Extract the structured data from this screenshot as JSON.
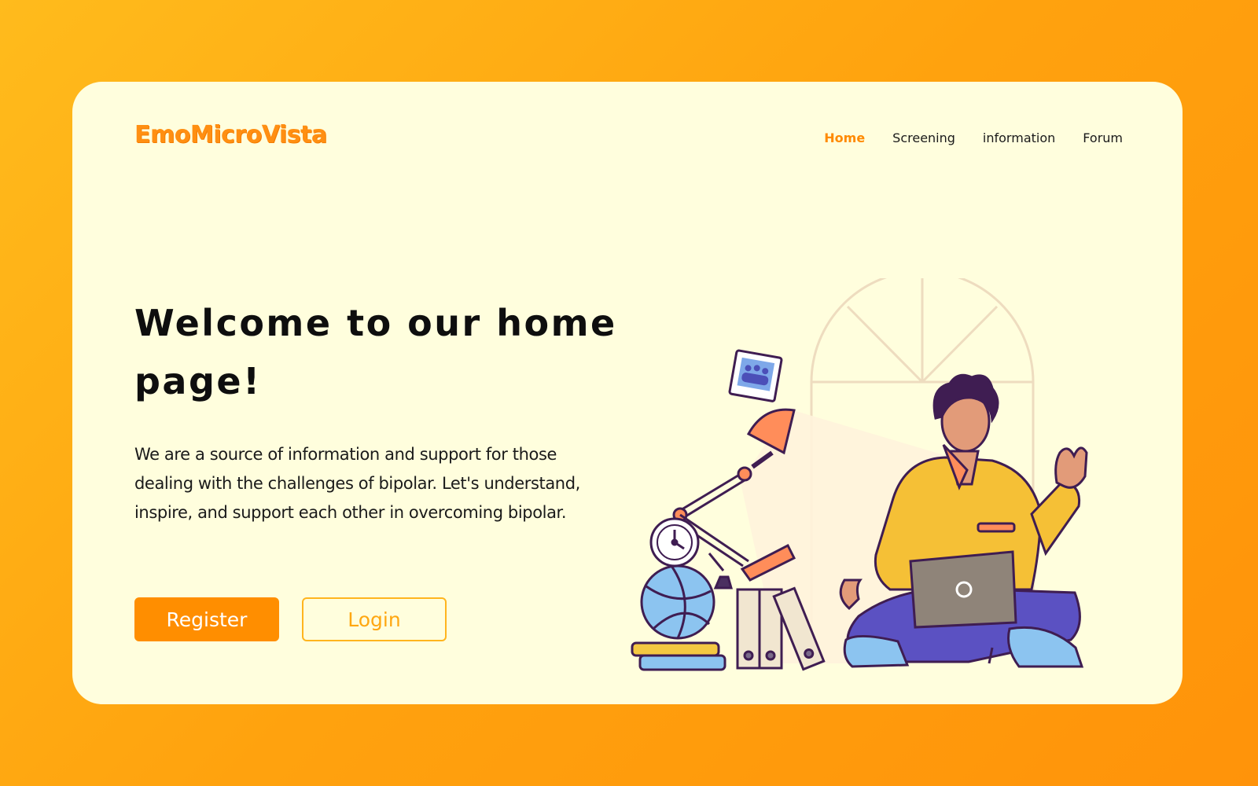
{
  "brand": {
    "name": "EmoMicroVista"
  },
  "nav": {
    "items": [
      {
        "label": "Home",
        "active": true
      },
      {
        "label": "Screening",
        "active": false
      },
      {
        "label": "information",
        "active": false
      },
      {
        "label": "Forum",
        "active": false
      }
    ]
  },
  "hero": {
    "title": "Welcome to our home page!",
    "description": "We are a source of information and support for those dealing with the challenges of bipolar. Let's understand, inspire, and support each other in overcoming bipolar.",
    "register_label": "Register",
    "login_label": "Login"
  },
  "colors": {
    "background_gradient": [
      "#FFBB1C",
      "#FF930A"
    ],
    "card": "#FFFEDD",
    "accent": "#FF8E00",
    "login_outline": "#FFB51E"
  },
  "illustration": {
    "subject": "person-sitting-with-laptop-illustration",
    "items": [
      "arched-window-icon",
      "desk-lamp-icon",
      "photo-frame-icon",
      "clock-icon",
      "globe-icon",
      "book-stack-icon",
      "binder-icon",
      "laptop-icon",
      "person-figure-icon"
    ]
  }
}
